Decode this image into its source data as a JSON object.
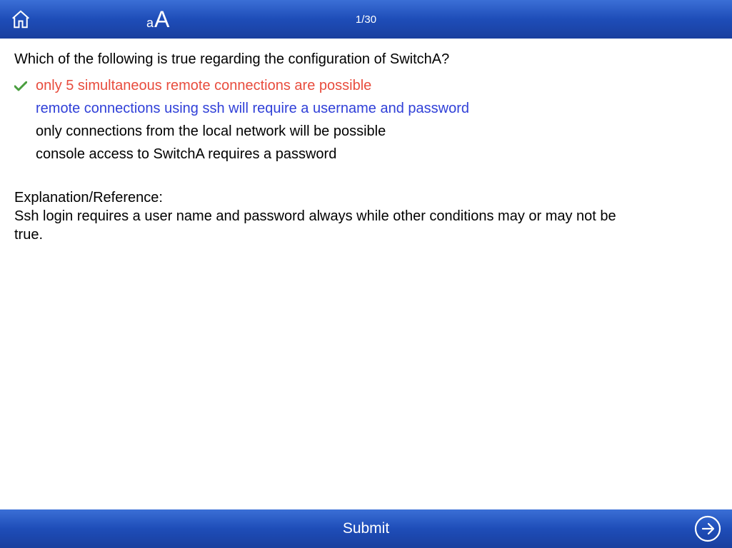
{
  "header": {
    "font_small": "a",
    "font_big": "A",
    "page_counter": "1/30"
  },
  "question": {
    "text": "Which of the following is true regarding the configuration of SwitchA?"
  },
  "answers": [
    {
      "text": "only 5 simultaneous remote connections are possible",
      "state": "selected-wrong",
      "mark": "check"
    },
    {
      "text": "remote connections using ssh will require a username and password",
      "state": "correct",
      "mark": ""
    },
    {
      "text": "only connections from the local network will be possible",
      "state": "normal",
      "mark": ""
    },
    {
      "text": "console access to SwitchA requires a password",
      "state": "normal",
      "mark": ""
    }
  ],
  "explanation": {
    "label": "Explanation/Reference:",
    "text": "Ssh login requires a user name and password always while other conditions may or may not be true."
  },
  "footer": {
    "submit": "Submit"
  }
}
